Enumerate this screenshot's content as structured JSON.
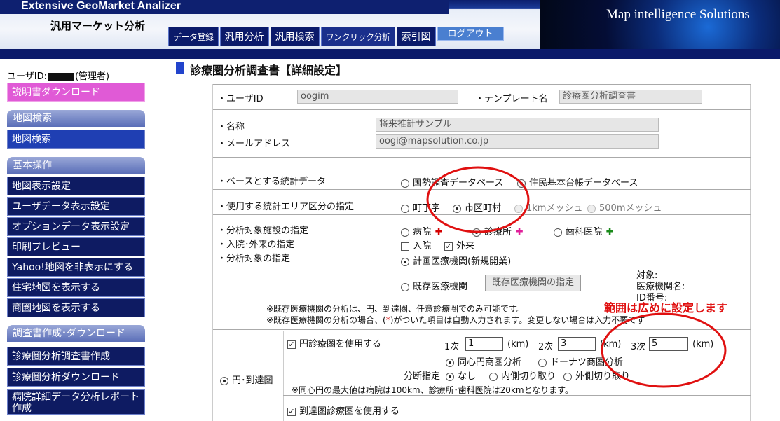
{
  "header": {
    "app_title": "Extensive GeoMarket Analizer",
    "app_subtitle": "汎用マーケット分析",
    "brand": "Map intelligence Solutions",
    "tabs": [
      "データ登録",
      "汎用分析",
      "汎用検索",
      "ワンクリック分析",
      "索引図"
    ],
    "logout": "ログアウト"
  },
  "sidebar": {
    "user_prefix": "ユーザID:",
    "user_role": "(管理者)",
    "download_manual": "説明書ダウンロード",
    "sections": {
      "map_search": {
        "title": "地図検索",
        "items": [
          "地図検索"
        ]
      },
      "basic": {
        "title": "基本操作",
        "items": [
          "地図表示設定",
          "ユーザデータ表示設定",
          "オプションデータ表示設定",
          "印刷プレビュー",
          "Yahoo!地図を非表示にする",
          "住宅地図を表示する",
          "商圏地図を表示する"
        ]
      },
      "report": {
        "title": "調査書作成･ダウンロード",
        "items": [
          "診療圏分析調査書作成",
          "診療圏分析ダウンロード",
          "病院詳細データ分析レポート作成"
        ]
      }
    }
  },
  "page": {
    "title": "診療圏分析調査書【詳細設定】"
  },
  "form": {
    "user_id_label": "・ユーザID",
    "user_id_value": "oogim",
    "template_label": "・テンプレート名",
    "template_value": "診療圏分析調査書",
    "name_label": "・名称",
    "name_value": "将来推計サンプル",
    "email_label": "・メールアドレス",
    "email_value": "oogi@mapsolution.co.jp",
    "base_stats_label": "・ベースとする統計データ",
    "base_stats_options": [
      "国勢調査データベース",
      "住民基本台帳データベース"
    ],
    "area_unit_label": "・使用する統計エリア区分の指定",
    "area_unit_options": [
      "町丁字",
      "市区町村",
      "1kmメッシュ",
      "500mメッシュ"
    ],
    "facility_label": "・分析対象施設の指定",
    "facility_options": [
      "病院",
      "診療所",
      "歯科医院"
    ],
    "inout_label": "・入院･外来の指定",
    "inout_options": [
      "入院",
      "外来"
    ],
    "target_label": "・分析対象の指定",
    "target_planned": "計画医療機関(新規開業)",
    "target_existing": "既存医療機関",
    "existing_button": "既存医療機関の指定",
    "target_info": [
      "対象:",
      "医療機関名:",
      "ID番号:"
    ],
    "note1": "※既存医療機関の分析は、円、到達圏、任意診療圏でのみ可能です。",
    "note2a": "※既存医療機関の分析の場合、(",
    "note2b": "*",
    "note2c": ")がついた項目は自動入力されます。変更しない場合は入力不要です",
    "circle_mode_label": "円･到達圏",
    "use_circle": "円診療圏を使用する",
    "radius": [
      {
        "label": "1次",
        "value": "1",
        "unit": "(km)"
      },
      {
        "label": "2次",
        "value": "3",
        "unit": "(km)"
      },
      {
        "label": "3次",
        "value": "5",
        "unit": "(km)"
      }
    ],
    "circle_type_options": [
      "同心円商圏分析",
      "ドーナツ商圏分析"
    ],
    "split_label": "分断指定",
    "split_options": [
      "なし",
      "内側切り取り",
      "外側切り取り"
    ],
    "max_note": "※同心円の最大値は病院は100km、診療所･歯科医院は20kmとなります。",
    "use_reach": "到達圏診療圏を使用する"
  },
  "annotation": {
    "text": "範囲は広めに設定します",
    "color": "#e01010"
  }
}
